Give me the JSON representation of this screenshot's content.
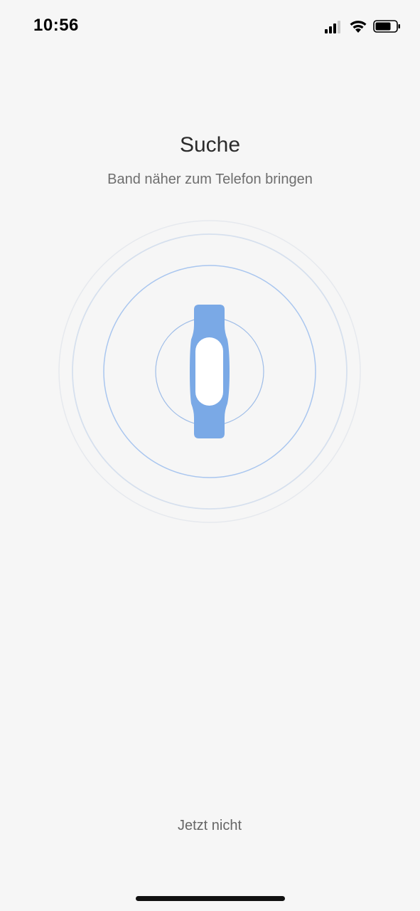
{
  "status_bar": {
    "time": "10:56",
    "icons": [
      "cellular-signal-icon",
      "wifi-icon",
      "battery-icon"
    ]
  },
  "header": {
    "title": "Suche",
    "subtitle": "Band näher zum Telefon bringen"
  },
  "illustration": {
    "icon": "fitness-band-icon",
    "band_color": "#7aa9e6",
    "ring_color": "#a9c6ef"
  },
  "actions": {
    "not_now_label": "Jetzt nicht"
  }
}
